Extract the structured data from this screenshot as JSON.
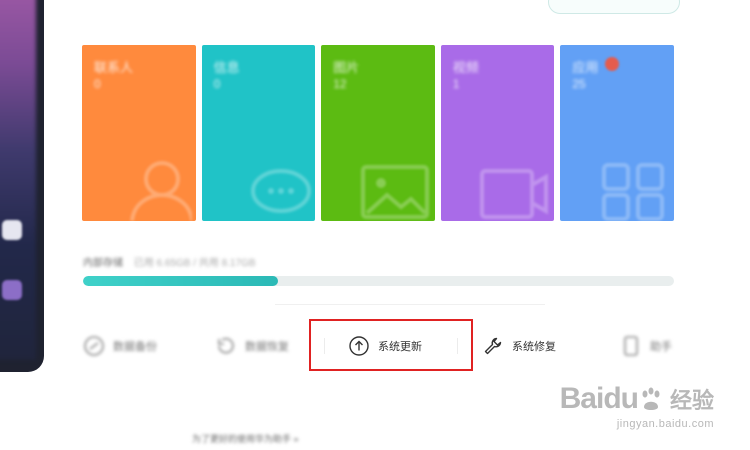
{
  "tiles": [
    {
      "label": "联系人",
      "count": "0",
      "color": "#ff8a3d",
      "icon": "person-icon"
    },
    {
      "label": "信息",
      "count": "0",
      "color": "#20c3c7",
      "icon": "chat-bubble-icon"
    },
    {
      "label": "图片",
      "count": "12",
      "color": "#5cbb12",
      "icon": "picture-icon"
    },
    {
      "label": "视频",
      "count": "1",
      "color": "#a96be8",
      "icon": "video-icon"
    },
    {
      "label": "应用",
      "count": "25",
      "color": "#62a0f5",
      "icon": "apps-icon",
      "badge_color": "#e55c4d"
    }
  ],
  "storage": {
    "label": "内部存储",
    "detail": "已用 6.65GB / 共用 8.17GB",
    "progress": 0.33,
    "fill_color": "#35c6c1"
  },
  "actions": [
    {
      "label": "数据备份",
      "icon": "backup-icon"
    },
    {
      "label": "数据恢复",
      "icon": "restore-icon"
    },
    {
      "label": "系统更新",
      "icon": "arrow-up-circle-icon",
      "highlighted": true
    },
    {
      "label": "系统修复",
      "icon": "wrench-icon"
    },
    {
      "label": "助手",
      "icon": "phone-icon"
    }
  ],
  "footer_link": "为了更好的使用华为助手 »",
  "watermark": {
    "logo": "Baidu",
    "cn": "经验",
    "url": "jingyan.baidu.com"
  },
  "highlight_color": "#e02222"
}
